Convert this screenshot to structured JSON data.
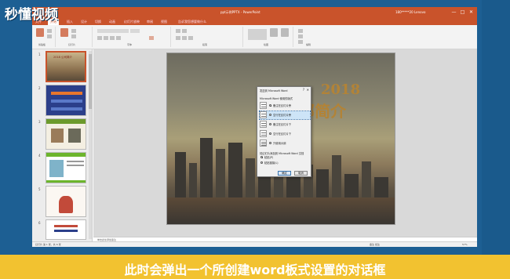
{
  "app": {
    "window_title": "ppt示例PPTX - PowerPoint",
    "account": "180*****20 Lenovo",
    "win_controls": [
      "—",
      "□",
      "✕"
    ]
  },
  "ribbon_tabs": [
    "文件",
    "开始",
    "插入",
    "设计",
    "切换",
    "动画",
    "幻灯片放映",
    "审阅",
    "视图",
    "告诉我您想要做什么"
  ],
  "active_tab": "开始",
  "ribbon_groups": [
    "剪贴板",
    "幻灯片",
    "字体",
    "段落",
    "绘图",
    "编辑"
  ],
  "thumbnails": [
    {
      "num": "1",
      "label": "2018 公司简介"
    },
    {
      "num": "2",
      "label": ""
    },
    {
      "num": "3",
      "label": ""
    },
    {
      "num": "4",
      "label": ""
    },
    {
      "num": "5",
      "label": ""
    },
    {
      "num": "6",
      "label": ""
    }
  ],
  "slide": {
    "year": "2018",
    "title": "部简介"
  },
  "dialog": {
    "title": "发送到 Microsoft Word",
    "help": "?",
    "close": "✕",
    "section1": "Microsoft Word 使用的版式",
    "options": [
      {
        "label": "备注在幻灯片旁",
        "selected": true
      },
      {
        "label": "空行在幻灯片旁",
        "selected": false
      },
      {
        "label": "备注在幻灯片下",
        "selected": false
      },
      {
        "label": "空行在幻灯片下",
        "selected": false
      },
      {
        "label": "只使用大纲",
        "selected": false
      }
    ],
    "section2": "将幻灯片添加到 Microsoft Word 文档",
    "paste_options": [
      {
        "label": "粘贴(P)",
        "selected": true
      },
      {
        "label": "粘贴链接(L)",
        "selected": false
      }
    ],
    "ok": "确定",
    "cancel": "取消"
  },
  "notes_placeholder": "单击此处添加备注",
  "status": {
    "left": "幻灯片 第 1 张，共 6 张",
    "right": "备注  批注",
    "zoom": "57%"
  },
  "overlay": {
    "logo": "秒懂视频",
    "caption": "此时会弹出一个所创建word板式设置的对话框"
  },
  "colors": {
    "accent": "#c9532b",
    "background": "#1d5f93",
    "caption_bar": "#f2c230"
  }
}
